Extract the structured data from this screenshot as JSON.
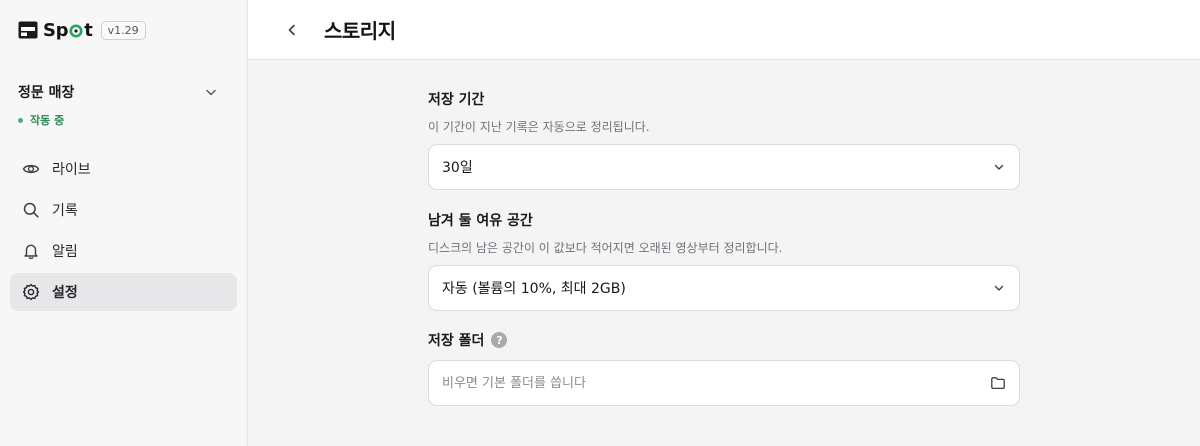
{
  "brand": {
    "name_before": "Sp",
    "name_after": "t",
    "version": "v1.29",
    "accent": "#27a35f"
  },
  "store": {
    "name": "정문 매장",
    "status": "작동 중",
    "status_color": "#47b07a"
  },
  "nav": {
    "items": [
      {
        "label": "라이브",
        "icon": "eye-icon"
      },
      {
        "label": "기록",
        "icon": "search-icon"
      },
      {
        "label": "알림",
        "icon": "bell-icon"
      },
      {
        "label": "설정",
        "icon": "gear-icon",
        "active": true
      }
    ]
  },
  "header": {
    "title": "스토리지"
  },
  "settings": {
    "retention": {
      "title": "저장 기간",
      "description": "이 기간이 지난 기록은 자동으로 정리됩니다.",
      "value": "30일"
    },
    "reserve": {
      "title": "남겨 둘 여유 공간",
      "description": "디스크의 남은 공간이 이 값보다 적어지면 오래된 영상부터 정리합니다.",
      "value": "자동 (볼륨의 10%, 최대 2GB)"
    },
    "folder": {
      "title": "저장 폴더",
      "help": "?",
      "value": "",
      "placeholder": "비우면 기본 폴더를 씁니다"
    }
  }
}
